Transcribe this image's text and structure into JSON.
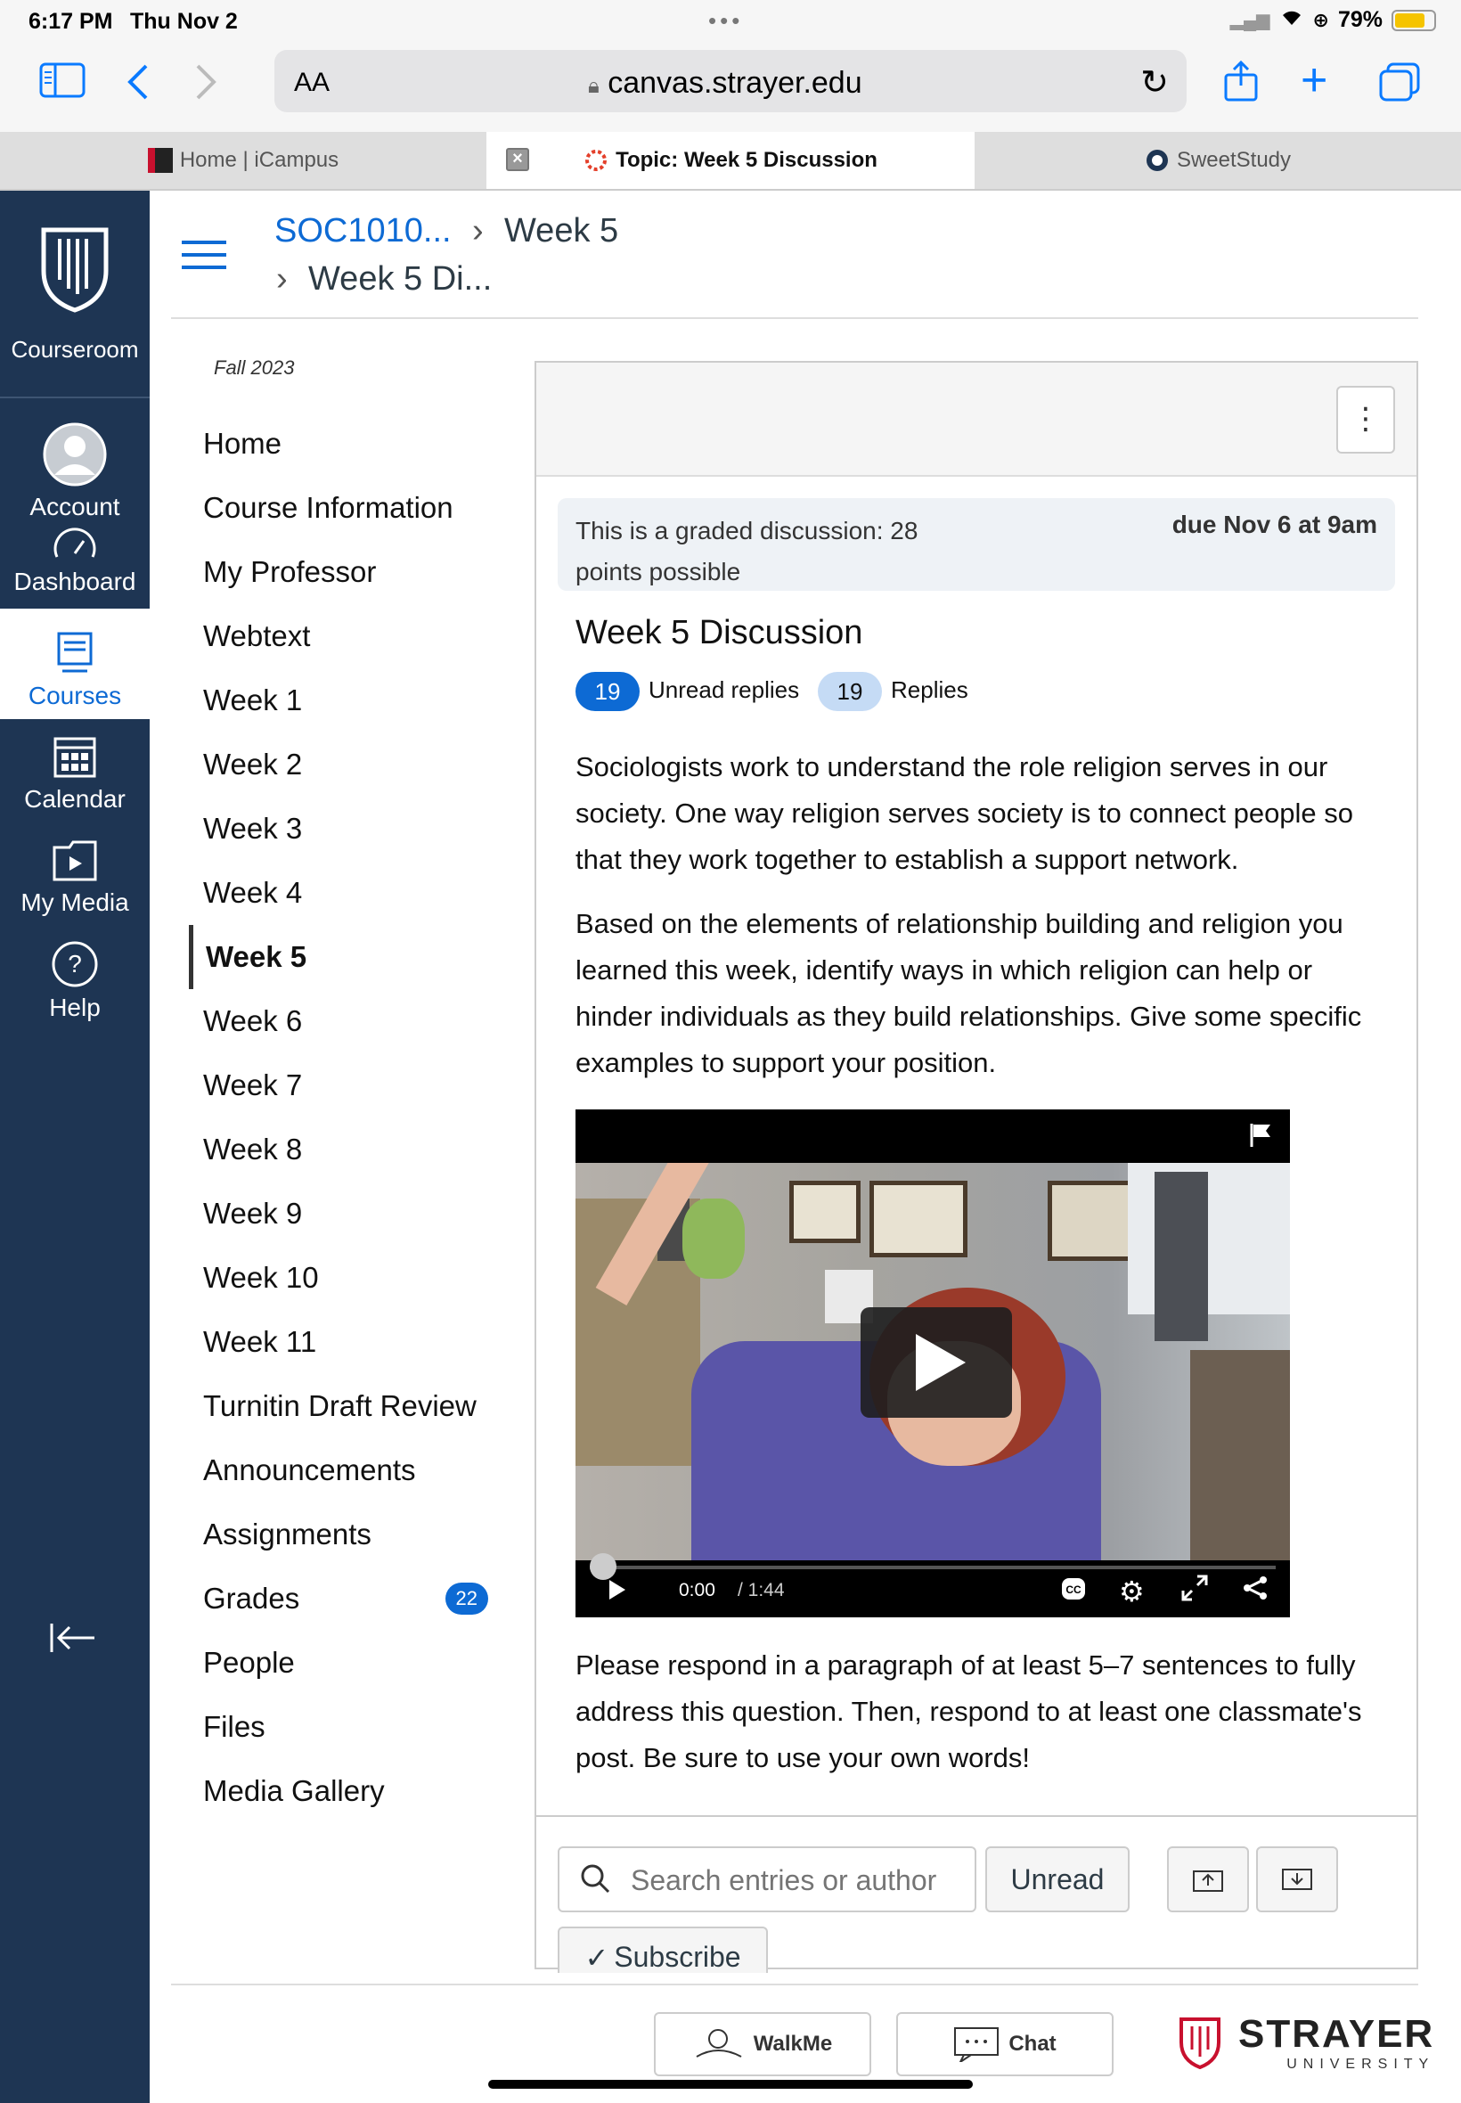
{
  "status": {
    "time": "6:17 PM",
    "date": "Thu Nov 2",
    "battery": "79%"
  },
  "browser": {
    "aa_label": "AA",
    "url": "canvas.strayer.edu"
  },
  "tabs": [
    {
      "label": "Home | iCampus"
    },
    {
      "label": "Topic: Week 5 Discussion"
    },
    {
      "label": "SweetStudy"
    }
  ],
  "global_nav": {
    "logo_label": "Courseroom",
    "items": [
      {
        "label": "Account",
        "icon": "account-icon"
      },
      {
        "label": "Dashboard",
        "icon": "dashboard-icon"
      },
      {
        "label": "Courses",
        "icon": "courses-icon"
      },
      {
        "label": "Calendar",
        "icon": "calendar-icon"
      },
      {
        "label": "My Media",
        "icon": "media-icon"
      },
      {
        "label": "Help",
        "icon": "help-icon"
      }
    ]
  },
  "breadcrumb": {
    "course": "SOC1010...",
    "week": "Week 5",
    "page": "Week 5 Di..."
  },
  "course_nav": {
    "term": "Fall 2023",
    "links": [
      "Home",
      "Course Information",
      "My Professor",
      "Webtext",
      "Week 1",
      "Week 2",
      "Week 3",
      "Week 4",
      "Week 5",
      "Week 6",
      "Week 7",
      "Week 8",
      "Week 9",
      "Week 10",
      "Week 11",
      "Turnitin Draft Review",
      "Announcements",
      "Assignments",
      "Grades",
      "People",
      "Files",
      "Media Gallery"
    ],
    "grades_badge": "22"
  },
  "discussion": {
    "graded_text": "This is a graded discussion: 28 points possible",
    "due": "due Nov 6 at 9am",
    "title": "Week 5 Discussion",
    "unread_count": "19",
    "unread_label": "Unread replies",
    "replies_count": "19",
    "replies_label": "Replies",
    "para1": "Sociologists work to understand the role religion serves in our society. One way religion serves society is to connect people so that they work together to establish a support network.",
    "para2": "Based on the elements of relationship building and religion you learned this week, identify ways in which religion can help or hinder individuals as they build relationships. Give some specific examples to support your position.",
    "para3": "Please respond in a paragraph of at least 5–7 sentences to fully address this question. Then, respond to at least one classmate's post. Be sure to use your own words!",
    "video": {
      "current": "0:00",
      "duration": "/ 1:44",
      "progress": 0
    }
  },
  "actions": {
    "search_placeholder": "Search entries or author",
    "unread_btn": "Unread",
    "subscribe_btn": "Subscribe"
  },
  "footer": {
    "walkme": "WalkMe",
    "chat": "Chat",
    "brand": "STRAYER",
    "brand_sub": "UNIVERSITY"
  },
  "colors": {
    "nav_bg": "#1e3553",
    "accent": "#0d6ad4",
    "ios_blue": "#0a7aff"
  }
}
